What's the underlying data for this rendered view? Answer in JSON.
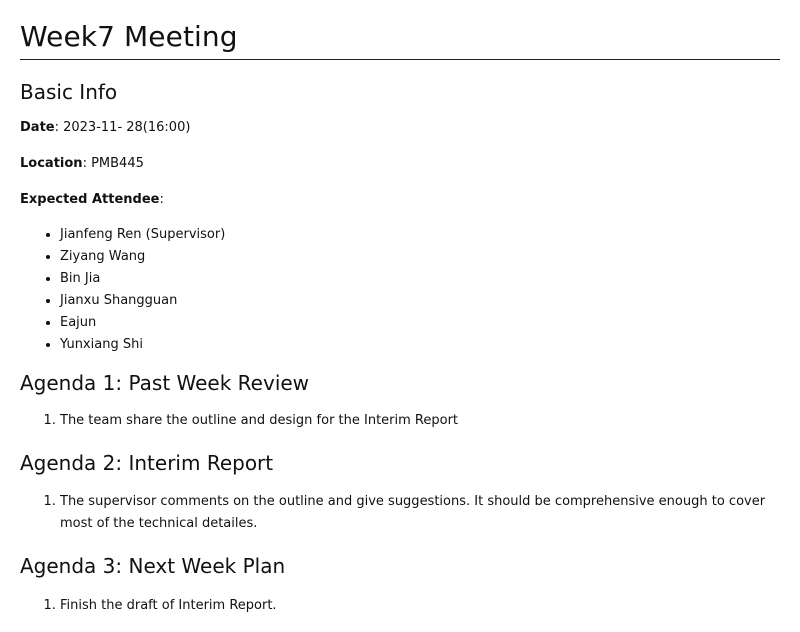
{
  "title": "Week7 Meeting",
  "basic_info": {
    "heading": "Basic Info",
    "date_label": "Date",
    "date_value": ": 2023-11- 28(16:00)",
    "location_label": "Location",
    "location_value": ": PMB445",
    "attendee_label": "Expected Attendee",
    "attendee_suffix": ":",
    "attendees": [
      "Jianfeng Ren (Supervisor)",
      "Ziyang Wang",
      "Bin Jia",
      "Jianxu Shangguan",
      "Eajun",
      "Yunxiang Shi"
    ]
  },
  "agenda1": {
    "heading": "Agenda 1: Past Week Review",
    "items": [
      "The team share the outline and design for the Interim Report"
    ]
  },
  "agenda2": {
    "heading": "Agenda 2: Interim Report",
    "items": [
      "The supervisor comments on the outline and give suggestions. It should be comprehensive enough to cover most of the technical detailes."
    ]
  },
  "agenda3": {
    "heading": "Agenda 3: Next Week Plan",
    "items": [
      "Finish the draft of Interim Report."
    ]
  }
}
